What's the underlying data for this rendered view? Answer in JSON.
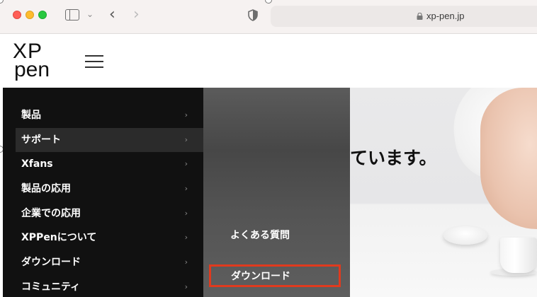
{
  "browser": {
    "url": "xp-pen.jp"
  },
  "header": {
    "logo_line1": "XP",
    "logo_line2": "pen"
  },
  "menu": {
    "items": [
      {
        "label": "製品",
        "chevron": "›"
      },
      {
        "label": "サポート",
        "chevron": "›"
      },
      {
        "label": "Xfans",
        "chevron": "›"
      },
      {
        "label": "製品の応用",
        "chevron": "›"
      },
      {
        "label": "企業での応用",
        "chevron": "›"
      },
      {
        "label": "XPPenについて",
        "chevron": "›"
      },
      {
        "label": "ダウンロード",
        "chevron": "›"
      },
      {
        "label": "コミュニティ",
        "chevron": "›"
      }
    ],
    "active_index": 1
  },
  "submenu": {
    "items": [
      {
        "label": "よくある質問"
      },
      {
        "label": "ダウンロード"
      }
    ],
    "highlight_color": "#e03a1e"
  },
  "hero": {
    "text": "ています。"
  },
  "icons": {
    "sidebar_toggle": "sidebar-icon",
    "back": "chevron-left-icon",
    "forward": "chevron-right-icon",
    "shield": "shield-icon",
    "lock": "lock-icon",
    "menu": "hamburger-icon"
  }
}
